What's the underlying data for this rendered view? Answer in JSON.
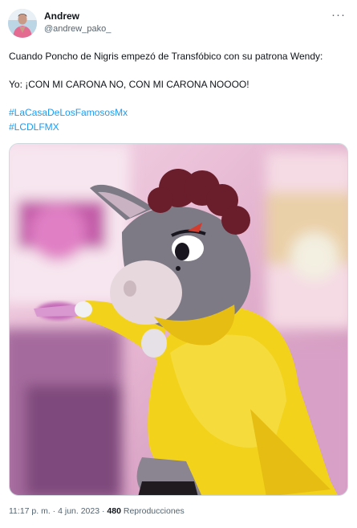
{
  "author": {
    "display_name": "Andrew",
    "handle": "@andrew_pako_",
    "more_glyph": "···"
  },
  "tweet": {
    "line1": "Cuando Poncho de Nigris empezó de Transfóbico con su patrona Wendy:",
    "line2": "Yo: ¡CON MI CARONA NO, CON MI CARONA NOOOO!",
    "hashtags": [
      "#LaCasaDeLosFamososMx",
      "#LCDLFMX"
    ]
  },
  "media": {
    "subject_colors": {
      "costume_fur": "#7d7a86",
      "snout": "#e6d8dc",
      "hair": "#6a1d2b",
      "raincoat": "#f2d21b",
      "background_pink": "#e3a8cf"
    }
  },
  "footer": {
    "time": "11:17 p. m.",
    "separator1": " · ",
    "date": "4 jun. 2023",
    "separator2": " · ",
    "views_count": "480",
    "views_label": " Reproducciones"
  },
  "colors": {
    "link": "#1d9bf0",
    "secondary_text": "#536471",
    "primary_text": "#0f1419"
  },
  "icons": [
    "more-options-icon"
  ]
}
